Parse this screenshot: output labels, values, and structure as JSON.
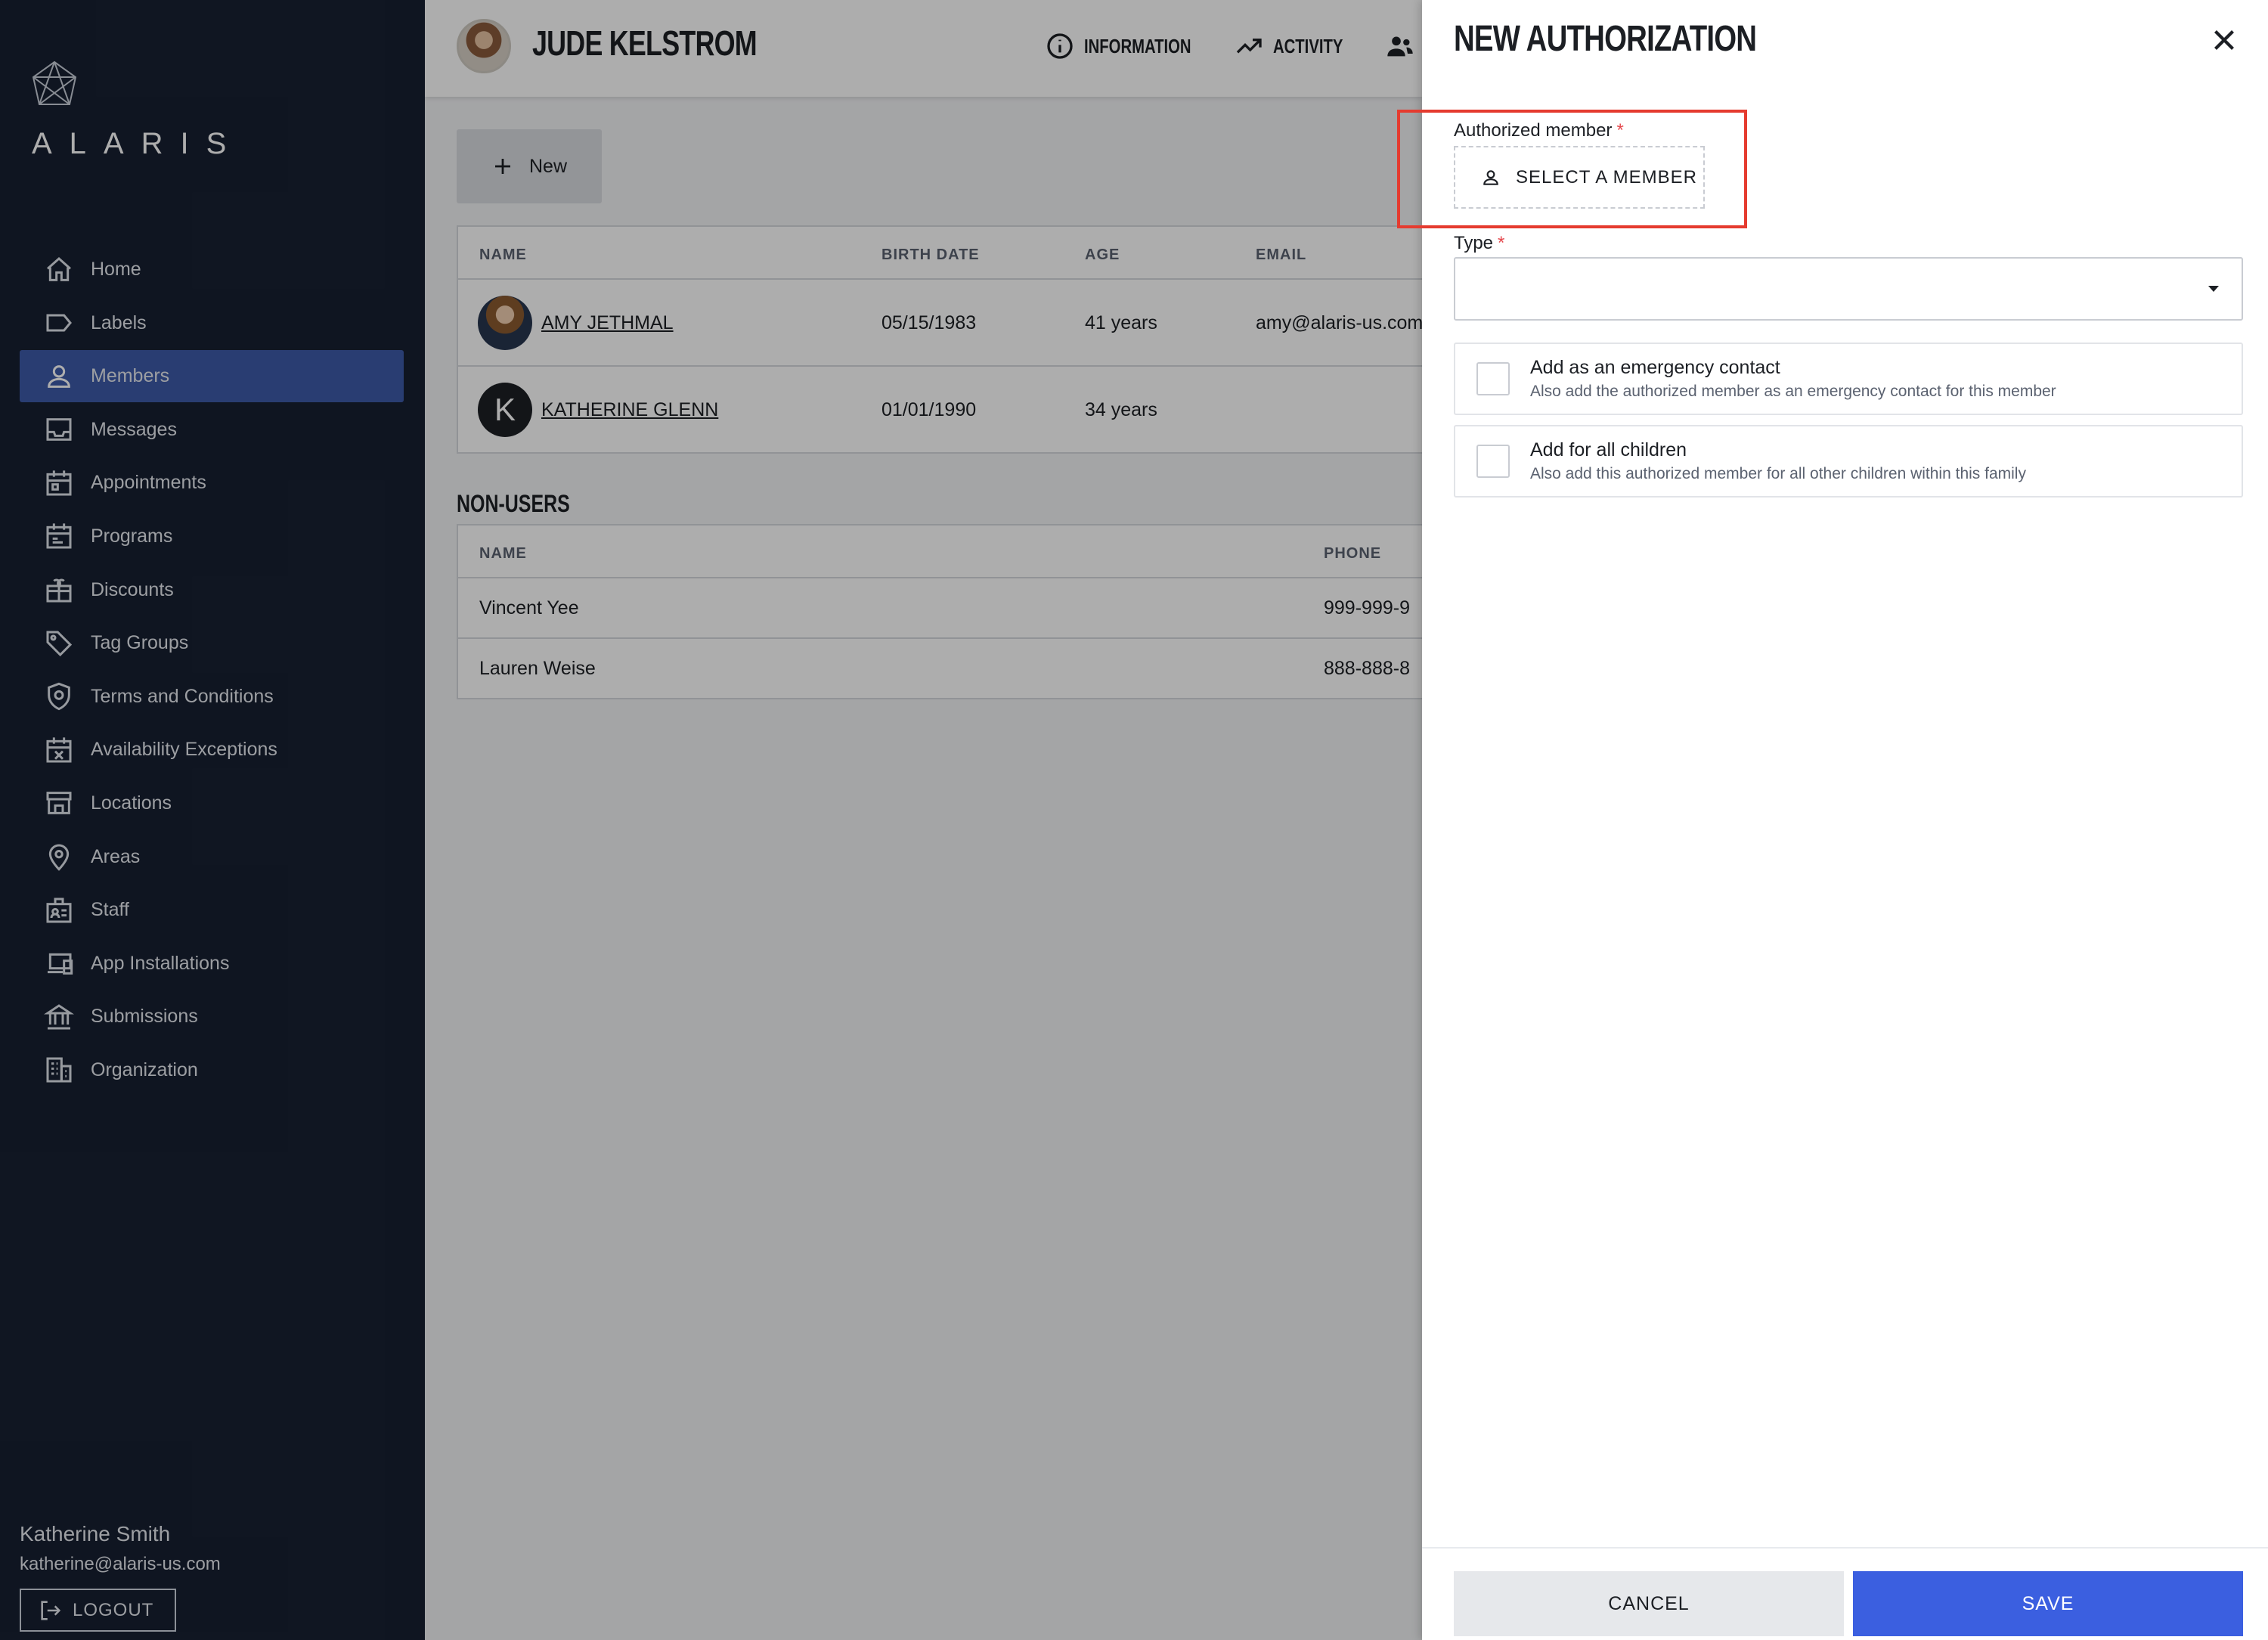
{
  "brand": {
    "name": "ALARIS"
  },
  "sidebar": {
    "items": [
      {
        "label": "Home",
        "icon": "home-icon"
      },
      {
        "label": "Labels",
        "icon": "label-icon"
      },
      {
        "label": "Members",
        "icon": "person-icon",
        "active": true
      },
      {
        "label": "Messages",
        "icon": "inbox-icon"
      },
      {
        "label": "Appointments",
        "icon": "calendar-icon"
      },
      {
        "label": "Programs",
        "icon": "programs-icon"
      },
      {
        "label": "Discounts",
        "icon": "gift-icon"
      },
      {
        "label": "Tag Groups",
        "icon": "tag-icon"
      },
      {
        "label": "Terms and Conditions",
        "icon": "shield-icon"
      },
      {
        "label": "Availability Exceptions",
        "icon": "calendar-x-icon"
      },
      {
        "label": "Locations",
        "icon": "store-icon"
      },
      {
        "label": "Areas",
        "icon": "map-pin-icon"
      },
      {
        "label": "Staff",
        "icon": "badge-icon"
      },
      {
        "label": "App Installations",
        "icon": "devices-icon"
      },
      {
        "label": "Submissions",
        "icon": "institution-icon"
      },
      {
        "label": "Organization",
        "icon": "building-icon"
      }
    ],
    "user": {
      "name": "Katherine Smith",
      "email": "katherine@alaris-us.com",
      "logout_label": "LOGOUT"
    }
  },
  "header": {
    "member_name": "JUDE KELSTROM",
    "tabs": [
      {
        "label": "INFORMATION",
        "icon": "info-icon"
      },
      {
        "label": "ACTIVITY",
        "icon": "trending-up-icon"
      },
      {
        "label": "",
        "icon": "people-icon"
      }
    ]
  },
  "main": {
    "new_button": "New",
    "users_table": {
      "columns": [
        "NAME",
        "BIRTH DATE",
        "AGE",
        "EMAIL"
      ],
      "rows": [
        {
          "name": "AMY JETHMAL",
          "birth_date": "05/15/1983",
          "age": "41 years",
          "email": "amy@alaris-us.com",
          "avatar_type": "photo"
        },
        {
          "name": "KATHERINE GLENN",
          "birth_date": "01/01/1990",
          "age": "34 years",
          "email": "",
          "avatar_initial": "K"
        }
      ]
    },
    "non_users": {
      "title": "NON-USERS",
      "columns": [
        "NAME",
        "PHONE"
      ],
      "rows": [
        {
          "name": "Vincent Yee",
          "phone": "999-999-9"
        },
        {
          "name": "Lauren Weise",
          "phone": "888-888-8"
        }
      ]
    }
  },
  "panel": {
    "title": "NEW AUTHORIZATION",
    "authorized_member_label": "Authorized member",
    "required_mark": "*",
    "select_member_label": "SELECT A MEMBER",
    "type_label": "Type",
    "type_value": "",
    "options": [
      {
        "title": "Add as an emergency contact",
        "subtitle": "Also add the authorized member as an emergency contact for this member",
        "checked": false
      },
      {
        "title": "Add for all children",
        "subtitle": "Also add this authorized member for all other children within this family",
        "checked": false
      }
    ],
    "cancel_label": "CANCEL",
    "save_label": "SAVE"
  },
  "colors": {
    "sidebar_bg": "#172032",
    "active_nav": "#3d5ba9",
    "save_button": "#3b5fe0",
    "highlight_border": "#e53b2f",
    "required": "#e5484d"
  }
}
